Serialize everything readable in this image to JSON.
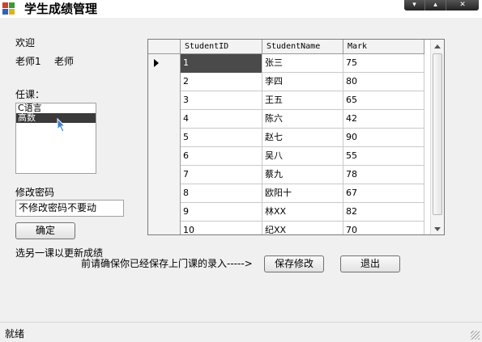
{
  "window": {
    "title": "学生成绩管理",
    "buttons": [
      "▾",
      "▴",
      "✕"
    ]
  },
  "sidebar": {
    "welcome": "欢迎",
    "user_name": "老师1",
    "user_role": "老师",
    "courses_label": "任课：",
    "courses": [
      "C语言",
      "高数"
    ],
    "selected_course": "高数",
    "password_label": "修改密码",
    "password_value": "不修改密码不要动",
    "confirm_label": "确定",
    "hint": "选另一课以更新成绩"
  },
  "grid": {
    "columns": [
      "StudentID",
      "StudentName",
      "Mark"
    ],
    "rows": [
      [
        "1",
        "张三",
        "75"
      ],
      [
        "2",
        "李四",
        "80"
      ],
      [
        "3",
        "王五",
        "65"
      ],
      [
        "4",
        "陈六",
        "42"
      ],
      [
        "5",
        "赵七",
        "90"
      ],
      [
        "6",
        "吴八",
        "55"
      ],
      [
        "7",
        "蔡九",
        "78"
      ],
      [
        "8",
        "欧阳十",
        "67"
      ],
      [
        "9",
        "林XX",
        "82"
      ],
      [
        "10",
        "纪XX",
        "70"
      ]
    ],
    "selected_row": 0
  },
  "actions": {
    "save_prompt": "前请确保你已经保存上门课的录入----->",
    "save_label": "保存修改",
    "exit_label": "退出"
  },
  "status": {
    "text": "就绪"
  },
  "colors": {
    "selection": "#3a3a3a",
    "window_bg": "#f0f0f0"
  }
}
